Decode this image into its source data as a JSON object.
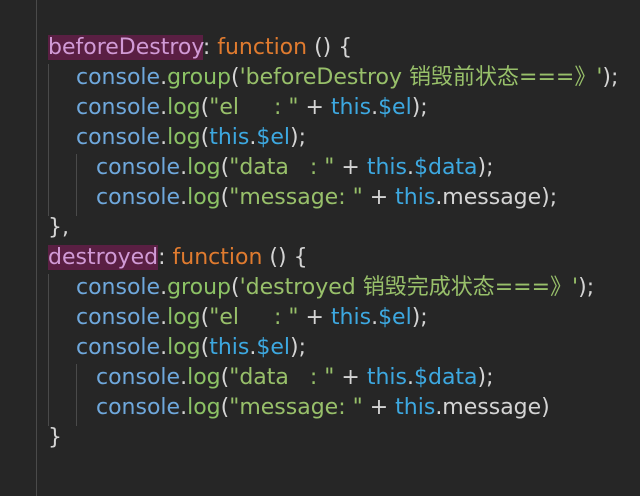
{
  "code": {
    "lines": [
      {
        "indent": 48,
        "tokens": [
          {
            "t": "method-name",
            "v": "beforeDestroy"
          },
          {
            "t": "punc",
            "v": ": "
          },
          {
            "t": "keyword",
            "v": "function"
          },
          {
            "t": "punc",
            "v": " () {"
          }
        ]
      },
      {
        "indent": 76,
        "tokens": [
          {
            "t": "ident",
            "v": "console"
          },
          {
            "t": "punc",
            "v": "."
          },
          {
            "t": "fn",
            "v": "group"
          },
          {
            "t": "punc",
            "v": "("
          },
          {
            "t": "string",
            "v": "'beforeDestroy 销毁前状态===》'"
          },
          {
            "t": "punc",
            "v": ");"
          }
        ]
      },
      {
        "indent": 76,
        "tokens": [
          {
            "t": "ident",
            "v": "console"
          },
          {
            "t": "punc",
            "v": "."
          },
          {
            "t": "fn",
            "v": "log"
          },
          {
            "t": "punc",
            "v": "("
          },
          {
            "t": "string",
            "v": "\"el     : \""
          },
          {
            "t": "punc",
            "v": " + "
          },
          {
            "t": "this",
            "v": "this"
          },
          {
            "t": "punc",
            "v": "."
          },
          {
            "t": "this",
            "v": "$el"
          },
          {
            "t": "punc",
            "v": ");"
          }
        ]
      },
      {
        "indent": 76,
        "tokens": [
          {
            "t": "ident",
            "v": "console"
          },
          {
            "t": "punc",
            "v": "."
          },
          {
            "t": "fn",
            "v": "log"
          },
          {
            "t": "punc",
            "v": "("
          },
          {
            "t": "this",
            "v": "this"
          },
          {
            "t": "punc",
            "v": "."
          },
          {
            "t": "this",
            "v": "$el"
          },
          {
            "t": "punc",
            "v": ");"
          }
        ]
      },
      {
        "indent": 96,
        "tokens": [
          {
            "t": "ident",
            "v": "console"
          },
          {
            "t": "punc",
            "v": "."
          },
          {
            "t": "fn",
            "v": "log"
          },
          {
            "t": "punc",
            "v": "("
          },
          {
            "t": "string",
            "v": "\"data   : \""
          },
          {
            "t": "punc",
            "v": " + "
          },
          {
            "t": "this",
            "v": "this"
          },
          {
            "t": "punc",
            "v": "."
          },
          {
            "t": "this",
            "v": "$data"
          },
          {
            "t": "punc",
            "v": ");"
          }
        ]
      },
      {
        "indent": 96,
        "tokens": [
          {
            "t": "ident",
            "v": "console"
          },
          {
            "t": "punc",
            "v": "."
          },
          {
            "t": "fn",
            "v": "log"
          },
          {
            "t": "punc",
            "v": "("
          },
          {
            "t": "string",
            "v": "\"message: \""
          },
          {
            "t": "punc",
            "v": " + "
          },
          {
            "t": "this",
            "v": "this"
          },
          {
            "t": "punc",
            "v": ".message);"
          }
        ]
      },
      {
        "indent": 48,
        "tokens": [
          {
            "t": "punc",
            "v": "},"
          }
        ]
      },
      {
        "indent": 48,
        "tokens": [
          {
            "t": "method-name",
            "v": "destroyed"
          },
          {
            "t": "punc",
            "v": ": "
          },
          {
            "t": "keyword",
            "v": "function"
          },
          {
            "t": "punc",
            "v": " () {"
          }
        ]
      },
      {
        "indent": 76,
        "tokens": [
          {
            "t": "ident",
            "v": "console"
          },
          {
            "t": "punc",
            "v": "."
          },
          {
            "t": "fn",
            "v": "group"
          },
          {
            "t": "punc",
            "v": "("
          },
          {
            "t": "string",
            "v": "'destroyed 销毁完成状态===》'"
          },
          {
            "t": "punc",
            "v": ");"
          }
        ]
      },
      {
        "indent": 76,
        "tokens": [
          {
            "t": "ident",
            "v": "console"
          },
          {
            "t": "punc",
            "v": "."
          },
          {
            "t": "fn",
            "v": "log"
          },
          {
            "t": "punc",
            "v": "("
          },
          {
            "t": "string",
            "v": "\"el     : \""
          },
          {
            "t": "punc",
            "v": " + "
          },
          {
            "t": "this",
            "v": "this"
          },
          {
            "t": "punc",
            "v": "."
          },
          {
            "t": "this",
            "v": "$el"
          },
          {
            "t": "punc",
            "v": ");"
          }
        ]
      },
      {
        "indent": 76,
        "tokens": [
          {
            "t": "ident",
            "v": "console"
          },
          {
            "t": "punc",
            "v": "."
          },
          {
            "t": "fn",
            "v": "log"
          },
          {
            "t": "punc",
            "v": "("
          },
          {
            "t": "this",
            "v": "this"
          },
          {
            "t": "punc",
            "v": "."
          },
          {
            "t": "this",
            "v": "$el"
          },
          {
            "t": "punc",
            "v": ");"
          }
        ]
      },
      {
        "indent": 96,
        "tokens": [
          {
            "t": "ident",
            "v": "console"
          },
          {
            "t": "punc",
            "v": "."
          },
          {
            "t": "fn",
            "v": "log"
          },
          {
            "t": "punc",
            "v": "("
          },
          {
            "t": "string",
            "v": "\"data   : \""
          },
          {
            "t": "punc",
            "v": " + "
          },
          {
            "t": "this",
            "v": "this"
          },
          {
            "t": "punc",
            "v": "."
          },
          {
            "t": "this",
            "v": "$data"
          },
          {
            "t": "punc",
            "v": ");"
          }
        ]
      },
      {
        "indent": 96,
        "tokens": [
          {
            "t": "ident",
            "v": "console"
          },
          {
            "t": "punc",
            "v": "."
          },
          {
            "t": "fn",
            "v": "log"
          },
          {
            "t": "punc",
            "v": "("
          },
          {
            "t": "string",
            "v": "\"message: \""
          },
          {
            "t": "punc",
            "v": " + "
          },
          {
            "t": "this",
            "v": "this"
          },
          {
            "t": "punc",
            "v": ".message)"
          }
        ]
      },
      {
        "indent": 48,
        "tokens": [
          {
            "t": "punc",
            "v": "}"
          }
        ]
      }
    ]
  }
}
